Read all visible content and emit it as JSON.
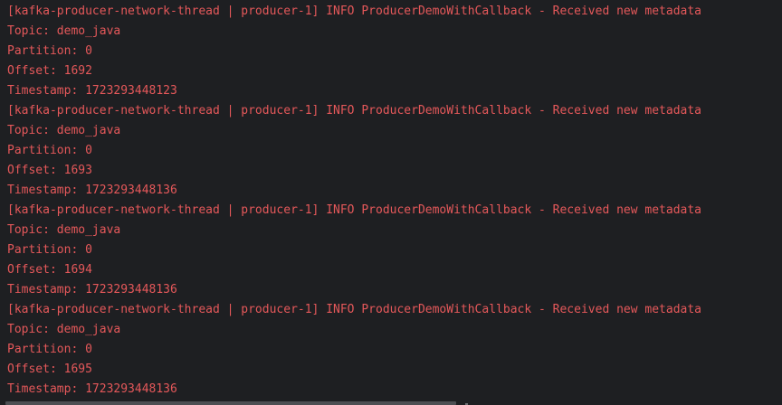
{
  "console": {
    "text_color": "#e5585a",
    "background": "#1e1f22",
    "lines": [
      "[kafka-producer-network-thread | producer-1] INFO ProducerDemoWithCallback - Received new metadata",
      "Topic: demo_java",
      "Partition: 0",
      "Offset: 1692",
      "Timestamp: 1723293448123",
      "[kafka-producer-network-thread | producer-1] INFO ProducerDemoWithCallback - Received new metadata",
      "Topic: demo_java",
      "Partition: 0",
      "Offset: 1693",
      "Timestamp: 1723293448136",
      "[kafka-producer-network-thread | producer-1] INFO ProducerDemoWithCallback - Received new metadata",
      "Topic: demo_java",
      "Partition: 0",
      "Offset: 1694",
      "Timestamp: 1723293448136",
      "[kafka-producer-network-thread | producer-1] INFO ProducerDemoWithCallback - Received new metadata",
      "Topic: demo_java",
      "Partition: 0",
      "Offset: 1695",
      "Timestamp: 1723293448136"
    ]
  }
}
